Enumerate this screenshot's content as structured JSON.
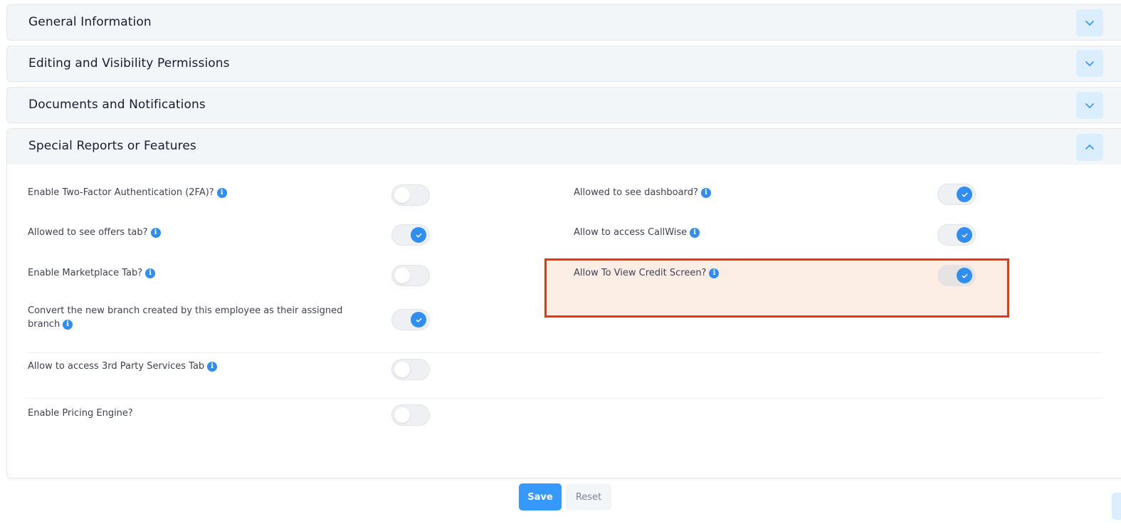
{
  "sections": {
    "general": "General Information",
    "editing": "Editing and Visibility Permissions",
    "documents": "Documents and Notifications",
    "special": "Special Reports or Features"
  },
  "settings": {
    "two_factor": {
      "label": "Enable Two-Factor Authentication (2FA)?",
      "enabled": false
    },
    "offers_tab": {
      "label": "Allowed to see offers tab?",
      "enabled": true
    },
    "marketplace_tab": {
      "label": "Enable Marketplace Tab?",
      "enabled": false
    },
    "convert_branch": {
      "label_line1": "Convert the new branch created by this employee as their assigned",
      "label_line2": "branch",
      "enabled": true
    },
    "third_party": {
      "label": "Allow to access 3rd Party Services Tab",
      "enabled": false
    },
    "pricing_engine": {
      "label": "Enable Pricing Engine?",
      "enabled": false
    },
    "dashboard": {
      "label": "Allowed to see dashboard?",
      "enabled": true
    },
    "callwise": {
      "label": "Allow to access CallWise",
      "enabled": true
    },
    "credit_screen": {
      "label": "Allow To View Credit Screen?",
      "enabled": true
    }
  },
  "info_glyph": "i",
  "buttons": {
    "save": "Save",
    "reset": "Reset"
  },
  "colors": {
    "accent": "#3699ff",
    "highlight_border": "#e8380d",
    "highlight_fill": "#fdeee5"
  }
}
